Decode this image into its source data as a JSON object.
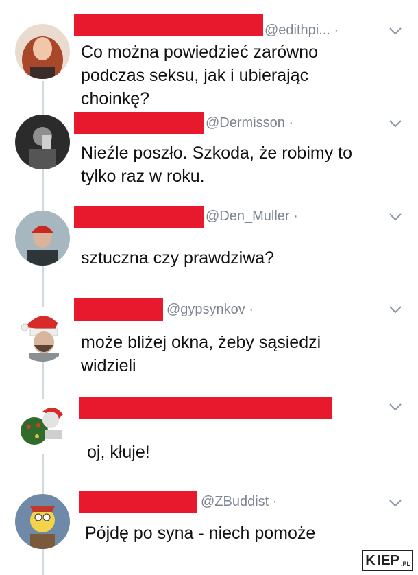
{
  "tweets": [
    {
      "handle": "@edithpi... ·",
      "text_lines": [
        "Co można powiedzieć zarówno",
        "podczas seksu, jak i ubierając",
        "choinkę?"
      ],
      "avatar": "woman-red-hair-avatar"
    },
    {
      "handle": "@Dermisson ·",
      "text_lines": [
        "Nieźle poszło. Szkoda, że robimy to",
        "tylko raz w roku."
      ],
      "avatar": "man-drinking-bw-avatar"
    },
    {
      "handle": "@Den_Muller ·",
      "text_lines": [
        "sztuczna czy prawdziwa?"
      ],
      "avatar": "man-red-beanie-avatar"
    },
    {
      "handle": "@gypsynkov ·",
      "text_lines": [
        "może bliżej okna, żeby sąsiedzi",
        "widzieli"
      ],
      "avatar": "santa-hat-cartoon-avatar"
    },
    {
      "handle": "",
      "text_lines": [
        "oj, kłuje!"
      ],
      "avatar": "christmas-wreath-avatar"
    },
    {
      "handle": "@ZBuddist ·",
      "text_lines": [
        "Pójdę po syna - niech pomoże"
      ],
      "avatar": "cartoon-character-avatar"
    }
  ],
  "watermark": {
    "brand": "KIEP",
    "box_letter": "K",
    "rest": "IEP",
    "tld": ".PL"
  },
  "colors": {
    "redaction": "#e8192c",
    "handle": "#7b8590",
    "text": "#111111",
    "thread_line": "#cfd9de"
  }
}
